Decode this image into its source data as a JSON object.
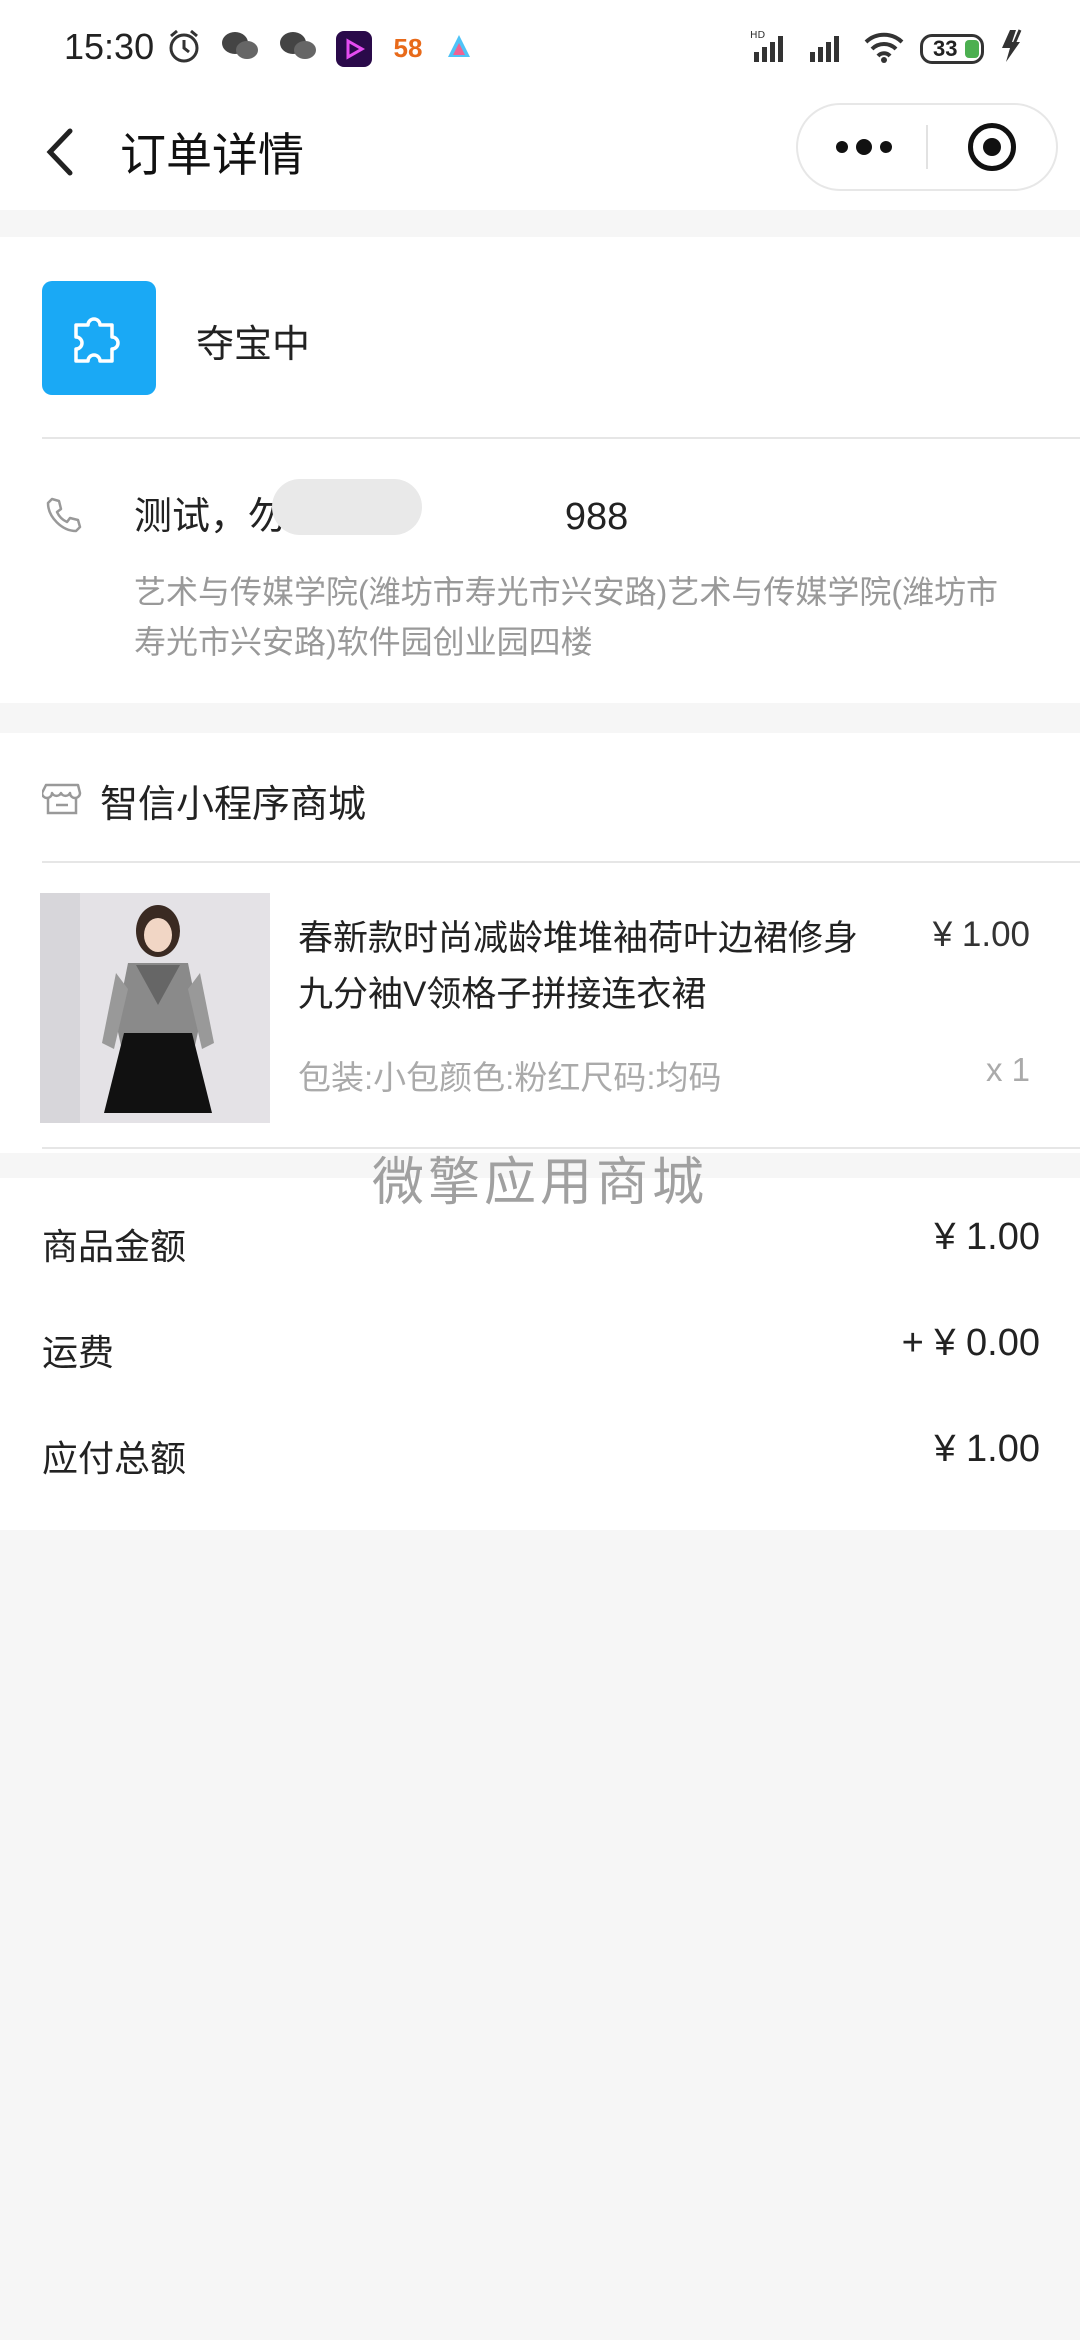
{
  "status_bar": {
    "time": "15:30",
    "icons": [
      "alarm-icon",
      "wechat-icon",
      "wechat-icon",
      "video-app-icon",
      "58-app-icon",
      "app-icon"
    ],
    "app_58_label": "58",
    "battery": "33"
  },
  "header": {
    "title": "订单详情"
  },
  "order": {
    "status_text": "夺宝中",
    "contact_text": "测试，勿发货 18",
    "contact_tail": "988",
    "address": "艺术与传媒学院(潍坊市寿光市兴安路)艺术与传媒学院(潍坊市寿光市兴安路)软件园创业园四楼"
  },
  "store": {
    "name": "智信小程序商城"
  },
  "product": {
    "name": "春新款时尚减龄堆堆袖荷叶边裙修身九分袖V领格子拼接连衣裙",
    "price": "¥ 1.00",
    "spec": "包装:小包颜色:粉红尺码:均码",
    "qty": "x 1"
  },
  "watermark": "微擎应用商城",
  "summary": {
    "rows": [
      {
        "label": "商品金额",
        "value": "¥ 1.00"
      },
      {
        "label": "运费",
        "value": "+ ¥ 0.00"
      },
      {
        "label": "应付总额",
        "value": "¥ 1.00"
      }
    ]
  },
  "colors": {
    "status_icon_bg": "#1aa9f5",
    "page_bg": "#f6f6f6"
  }
}
